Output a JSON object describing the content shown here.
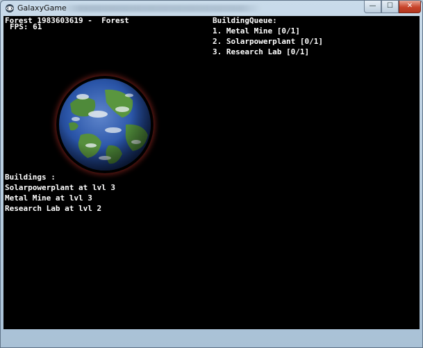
{
  "window": {
    "title": "GalaxyGame",
    "controls": {
      "minimize_glyph": "—",
      "maximize_glyph": "☐",
      "close_glyph": "✕"
    }
  },
  "hud": {
    "planet_info": "Forest 1983603619 -  Forest",
    "fps": "FPS: 61",
    "queue": {
      "title": "BuildingQueue:",
      "items": [
        "1. Metal Mine [0/1]",
        "2. Solarpowerplant [0/1]",
        "3. Research Lab [0/1]"
      ]
    },
    "buildings": {
      "title": "Buildings :",
      "items": [
        "Solarpowerplant at lvl 3",
        "Metal Mine at lvl 3",
        "Research Lab at lvl 2"
      ]
    }
  },
  "colors": {
    "background": "#000000",
    "hud_text": "#ffffff",
    "ocean": "#2a55a8",
    "land": "#4f8a3a",
    "cloud": "#e6ecef",
    "atmosphere": "#b43428"
  },
  "icons": {
    "app": "galaxy-icon",
    "planet": "planet-icon"
  }
}
